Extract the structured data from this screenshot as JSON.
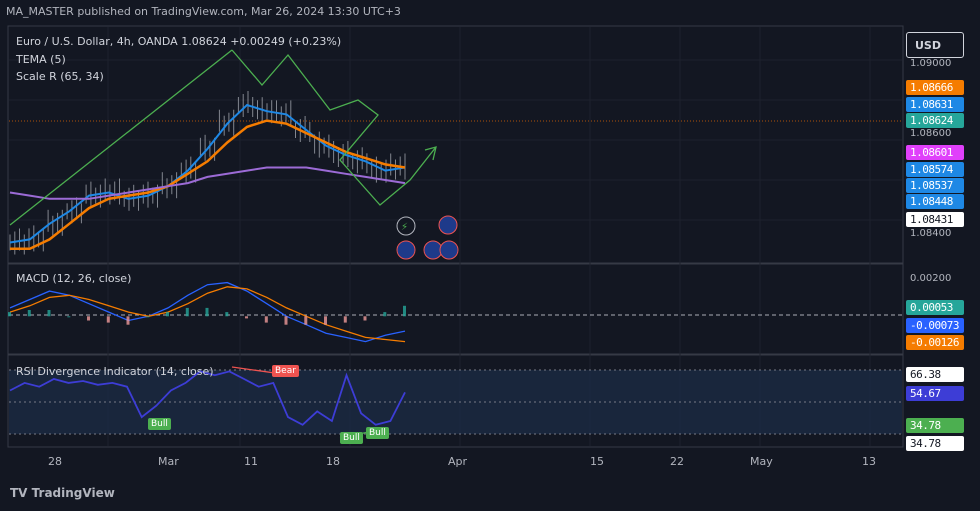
{
  "header": {
    "text": "MA_MASTER published on TradingView.com, Mar 26, 2024 13:30 UTC+3"
  },
  "footer": {
    "logo_text": "TradingView"
  },
  "main_pane": {
    "legend_title": "Euro / U.S. Dollar, 4h, OANDA  1.08624  +0.00249 (+0.23%)",
    "legend_tema": "TEMA (5)",
    "legend_scale": "Scale R (65, 34)",
    "currency_button": "USD",
    "price_labels": [
      {
        "text": "1.09000",
        "style": "tick"
      },
      {
        "text": "1.08666",
        "bg": "#f57c00",
        "fg": "#ffffff"
      },
      {
        "text": "1.08631",
        "bg": "#1e88e5",
        "fg": "#ffffff"
      },
      {
        "text": "1.08624",
        "bg": "#26a69a",
        "fg": "#ffffff"
      },
      {
        "text": "1.08600",
        "style": "tick"
      },
      {
        "text": "1.08601",
        "bg": "#e040fb",
        "fg": "#ffffff"
      },
      {
        "text": "1.08574",
        "bg": "#1e88e5",
        "fg": "#ffffff"
      },
      {
        "text": "1.08537",
        "bg": "#1e88e5",
        "fg": "#ffffff"
      },
      {
        "text": "1.08448",
        "bg": "#1e88e5",
        "fg": "#ffffff"
      },
      {
        "text": "1.08431",
        "bg": "#ffffff",
        "fg": "#131722"
      },
      {
        "text": "1.08400",
        "style": "tick"
      }
    ],
    "colors": {
      "tema": "#1e88e5",
      "ma_orange": "#f57c00",
      "ma_purple": "#9c6bd6",
      "trendline": "#4caf50",
      "price": "#b2b5be"
    }
  },
  "macd_pane": {
    "legend": "MACD (12, 26, close)",
    "labels": [
      {
        "text": "0.00200",
        "style": "tick"
      },
      {
        "text": "0.00053",
        "bg": "#26a69a",
        "fg": "#ffffff"
      },
      {
        "text": "-0.00073",
        "bg": "#2962ff",
        "fg": "#ffffff"
      },
      {
        "text": "-0.00126",
        "bg": "#f57c00",
        "fg": "#ffffff"
      }
    ]
  },
  "rsi_pane": {
    "legend": "RSI Divergence Indicator (14, close)",
    "labels": [
      {
        "text": "66.38",
        "bg": "#ffffff",
        "fg": "#131722"
      },
      {
        "text": "54.67",
        "bg": "#3d3dd6",
        "fg": "#ffffff"
      },
      {
        "text": "34.78",
        "bg": "#4caf50",
        "fg": "#ffffff"
      },
      {
        "text": "34.78",
        "bg": "#ffffff",
        "fg": "#131722"
      }
    ],
    "markers": [
      {
        "text": "Bear",
        "color": "#ef5350"
      },
      {
        "text": "Bull",
        "color": "#4caf50"
      },
      {
        "text": "Bull",
        "color": "#4caf50"
      },
      {
        "text": "Bull",
        "color": "#4caf50"
      }
    ]
  },
  "x_axis": {
    "ticks": [
      "28",
      "Mar",
      "11",
      "18",
      "Apr",
      "15",
      "22",
      "May",
      "13"
    ]
  },
  "chart_data": [
    {
      "type": "line",
      "title": "Euro / U.S. Dollar, 4h, OANDA",
      "xlabel": "",
      "ylabel": "",
      "y_range": [
        1.0838,
        1.091
      ],
      "series": [
        {
          "name": "TEMA (5)",
          "values": [
            1.0842,
            1.0843,
            1.0848,
            1.0852,
            1.0857,
            1.0858,
            1.0856,
            1.0857,
            1.086,
            1.0865,
            1.0872,
            1.088,
            1.0886,
            1.0884,
            1.0883,
            1.0878,
            1.0873,
            1.087,
            1.0868,
            1.0865,
            1.0866
          ]
        },
        {
          "values": [
            1.084,
            1.084,
            1.0843,
            1.0848,
            1.0853,
            1.0856,
            1.0857,
            1.0858,
            1.086,
            1.0864,
            1.0868,
            1.0874,
            1.0879,
            1.0881,
            1.088,
            1.0877,
            1.0874,
            1.0871,
            1.0869,
            1.0867,
            1.0866
          ]
        },
        {
          "values": [
            1.0858,
            1.0857,
            1.0856,
            1.0856,
            1.0856,
            1.0857,
            1.0858,
            1.0859,
            1.086,
            1.0861,
            1.0863,
            1.0864,
            1.0865,
            1.0866,
            1.0866,
            1.0866,
            1.0865,
            1.0864,
            1.0863,
            1.0862,
            1.0861
          ]
        }
      ]
    },
    {
      "type": "line",
      "title": "MACD (12, 26, close)",
      "y_range": [
        -0.0016,
        0.0022
      ],
      "series": [
        {
          "name": "MACD",
          "values": [
            0.0004,
            0.0008,
            0.0012,
            0.001,
            0.0006,
            0.0002,
            -0.0002,
            0.0,
            0.0004,
            0.001,
            0.0015,
            0.0016,
            0.0012,
            0.0006,
            0.0,
            -0.0004,
            -0.0008,
            -0.001,
            -0.0012,
            -0.0009,
            -0.0007
          ]
        },
        {
          "name": "Signal",
          "values": [
            0.0002,
            0.0005,
            0.0009,
            0.001,
            0.0008,
            0.0005,
            0.0002,
            0.0,
            0.0002,
            0.0006,
            0.0011,
            0.0014,
            0.0013,
            0.0009,
            0.0004,
            0.0,
            -0.0004,
            -0.0007,
            -0.001,
            -0.0011,
            -0.0012
          ]
        }
      ]
    },
    {
      "type": "line",
      "title": "RSI Divergence Indicator (14, close)",
      "y_range": [
        30,
        72
      ],
      "series": [
        {
          "name": "RSI",
          "values": [
            56,
            60,
            58,
            62,
            60,
            61,
            59,
            60,
            58,
            42,
            48,
            56,
            60,
            66,
            64,
            66,
            62,
            58,
            60,
            42,
            38,
            45,
            40,
            64,
            44,
            38,
            40,
            55
          ]
        }
      ]
    }
  ]
}
